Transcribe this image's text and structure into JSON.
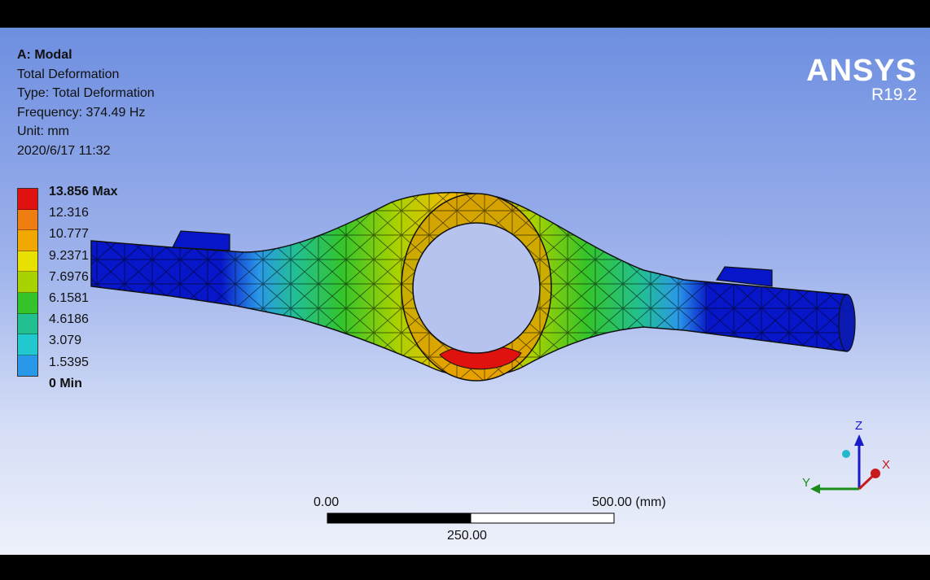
{
  "info": {
    "analysis_name": "A: Modal",
    "result_name": "Total Deformation",
    "type_line": "Type: Total Deformation",
    "frequency_line": "Frequency: 374.49 Hz",
    "unit_line": "Unit: mm",
    "date_line": "2020/6/17 11:32"
  },
  "brand": {
    "name": "ANSYS",
    "version": "R19.2"
  },
  "legend": {
    "labels": [
      "13.856 Max",
      "12.316",
      "10.777",
      "9.2371",
      "7.6976",
      "6.1581",
      "4.6186",
      "3.079",
      "1.5395",
      "0 Min"
    ],
    "colors": [
      "#e0120f",
      "#f07d10",
      "#f0a800",
      "#e8e000",
      "#a8d200",
      "#34c42a",
      "#22c090",
      "#21c8d0",
      "#2a98e8",
      "#0716c8"
    ]
  },
  "scale_bar": {
    "left_label": "0.00",
    "right_label": "500.00 (mm)",
    "mid_label": "250.00"
  },
  "triad": {
    "z_label": "Z",
    "y_label": "Y",
    "x_label": "X"
  },
  "colors": {
    "axis_z": "#1a1ac8",
    "axis_y": "#1a8c1a",
    "axis_x": "#c81a1a"
  }
}
